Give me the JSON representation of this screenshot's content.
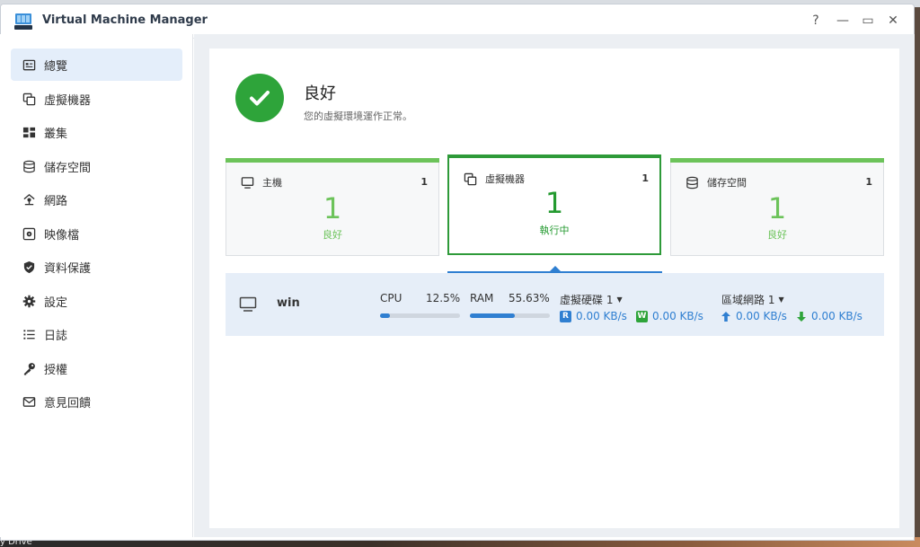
{
  "window": {
    "title": "Virtual Machine Manager",
    "controls": {
      "help": "?",
      "minimize": "—",
      "maximize": "▭",
      "close": "✕"
    }
  },
  "sidebar": {
    "items": [
      {
        "label": "總覽",
        "icon": "overview-icon",
        "active": true
      },
      {
        "label": "虛擬機器",
        "icon": "vm-copy-icon"
      },
      {
        "label": "叢集",
        "icon": "cluster-icon"
      },
      {
        "label": "儲存空間",
        "icon": "storage-icon"
      },
      {
        "label": "網路",
        "icon": "network-icon"
      },
      {
        "label": "映像檔",
        "icon": "image-disc-icon"
      },
      {
        "label": "資料保護",
        "icon": "shield-icon"
      },
      {
        "label": "設定",
        "icon": "gear-icon"
      },
      {
        "label": "日誌",
        "icon": "log-list-icon"
      },
      {
        "label": "授權",
        "icon": "key-icon"
      },
      {
        "label": "意見回饋",
        "icon": "mail-icon"
      }
    ]
  },
  "status": {
    "title": "良好",
    "description": "您的虛擬環境運作正常。"
  },
  "cards": [
    {
      "label": "主機",
      "count": "1",
      "number": "1",
      "state": "良好"
    },
    {
      "label": "虛擬機器",
      "count": "1",
      "number": "1",
      "state": "執行中"
    },
    {
      "label": "儲存空間",
      "count": "1",
      "number": "1",
      "state": "良好"
    }
  ],
  "vm": {
    "name": "win",
    "cpu_label": "CPU",
    "cpu_value": "12.5%",
    "cpu_fraction": 0.125,
    "ram_label": "RAM",
    "ram_value": "55.63%",
    "ram_fraction": 0.5563,
    "disk_label": "虛擬硬碟 1",
    "disk_read_badge": "R",
    "disk_read": "0.00 KB/s",
    "disk_write_badge": "W",
    "disk_write": "0.00 KB/s",
    "net_label": "區域網路 1",
    "net_up": "0.00 KB/s",
    "net_down": "0.00 KB/s"
  },
  "desktop": {
    "label": "y Drive"
  },
  "colors": {
    "accent": "#2f7fd1",
    "success": "#2ea43a",
    "success_light": "#6cc35a"
  }
}
